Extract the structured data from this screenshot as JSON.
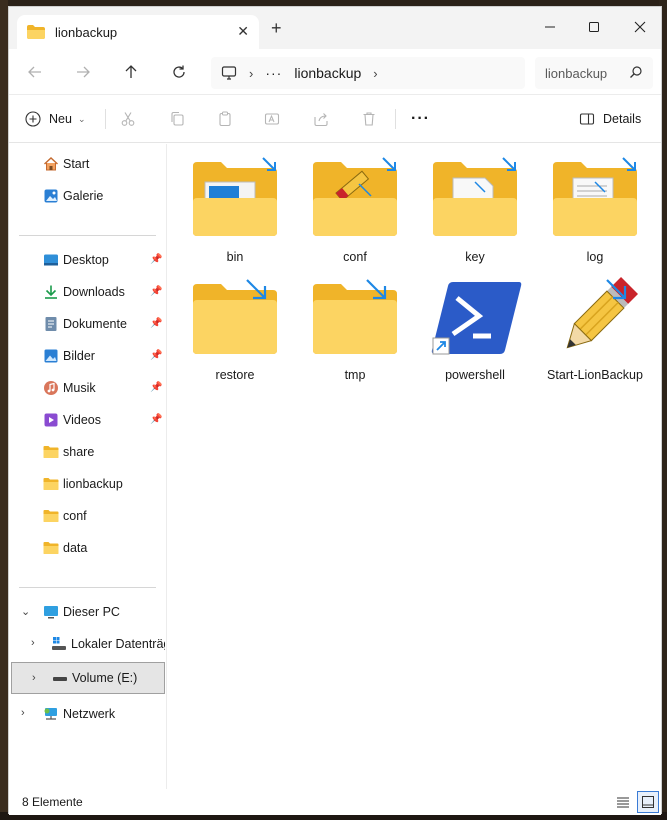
{
  "window": {
    "tab_title": "lionbackup",
    "new_tab_symbol": "+",
    "minimize_symbol": "—",
    "maximize_symbol": "☐",
    "close_symbol": "✕"
  },
  "address": {
    "more_symbol": "···",
    "crumb": "lionbackup",
    "search_placeholder": "lionbackup durchsuchen"
  },
  "commands": {
    "new_label": "Neu",
    "more_symbol": "···",
    "details_label": "Details"
  },
  "sidebar": {
    "quick": [
      {
        "label": "Start",
        "icon": "home-icon"
      },
      {
        "label": "Galerie",
        "icon": "gallery-icon"
      }
    ],
    "pinned": [
      {
        "label": "Desktop",
        "icon": "desktop-icon",
        "pinned": true
      },
      {
        "label": "Downloads",
        "icon": "download-icon",
        "pinned": true
      },
      {
        "label": "Dokumente",
        "icon": "documents-icon",
        "pinned": true
      },
      {
        "label": "Bilder",
        "icon": "pictures-icon",
        "pinned": true
      },
      {
        "label": "Musik",
        "icon": "music-icon",
        "pinned": true
      },
      {
        "label": "Videos",
        "icon": "videos-icon",
        "pinned": true
      },
      {
        "label": "share",
        "icon": "folder-icon"
      },
      {
        "label": "lionbackup",
        "icon": "folder-icon"
      },
      {
        "label": "conf",
        "icon": "folder-icon"
      },
      {
        "label": "data",
        "icon": "folder-icon"
      }
    ],
    "tree": [
      {
        "label": "Dieser PC",
        "icon": "pc-icon",
        "expanded": true
      },
      {
        "label": "Lokaler Datenträger (C:)",
        "icon": "drive-c-icon"
      },
      {
        "label": "Volume (E:)",
        "icon": "drive-icon",
        "selected": true
      },
      {
        "label": "Netzwerk",
        "icon": "network-icon"
      }
    ]
  },
  "items": [
    {
      "name": "bin",
      "kind": "folder",
      "badge": "blue-window"
    },
    {
      "name": "conf",
      "kind": "folder",
      "badge": "pencil"
    },
    {
      "name": "key",
      "kind": "folder",
      "badge": "paper"
    },
    {
      "name": "log",
      "kind": "folder",
      "badge": "lines"
    },
    {
      "name": "restore",
      "kind": "folder",
      "badge": "none"
    },
    {
      "name": "tmp",
      "kind": "folder",
      "badge": "none"
    },
    {
      "name": "powershell",
      "kind": "shortcut"
    },
    {
      "name": "Start-LionBackup",
      "kind": "script"
    }
  ],
  "status": {
    "count_text": "8 Elemente"
  },
  "colors": {
    "folder_back": "#f0b429",
    "folder_front": "#fcd462",
    "accent": "#0067c0",
    "compress_arrow": "#1e88e5",
    "powershell": "#2b5bc8"
  }
}
